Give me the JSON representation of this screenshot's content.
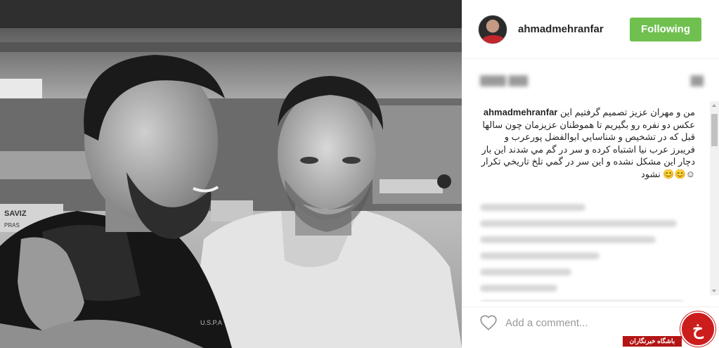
{
  "post": {
    "username": "ahmadmehranfar",
    "follow_label": "Following",
    "caption_user": "ahmadmehranfar",
    "caption_text": "من و مهران عزيز تصميم گرفتيم اين عكس دو نفره رو بگيريم تا هموطنان عزيزمان چون سالها قبل كه در تشخيص و شناسايي ابوالفضل پورعرب و فريبرز عرب نيا اشتباه كرده و سر در گم مي شدند اين بار دچار اين مشكل نشده و اين سر در گمي تلخ تاريخي تكرار نشود 😊😊☺",
    "comment_placeholder": "Add a comment...",
    "photo_sign_text": "SAVIZ",
    "photo_sign_text_2": "PRAS",
    "shirt_logo": "U.S.P.A"
  },
  "watermark": {
    "logo_glyph": "خ",
    "text": "باشگاه خبرنگاران"
  },
  "colors": {
    "follow_button": "#70c050",
    "watermark_red": "#cc1d1d"
  }
}
